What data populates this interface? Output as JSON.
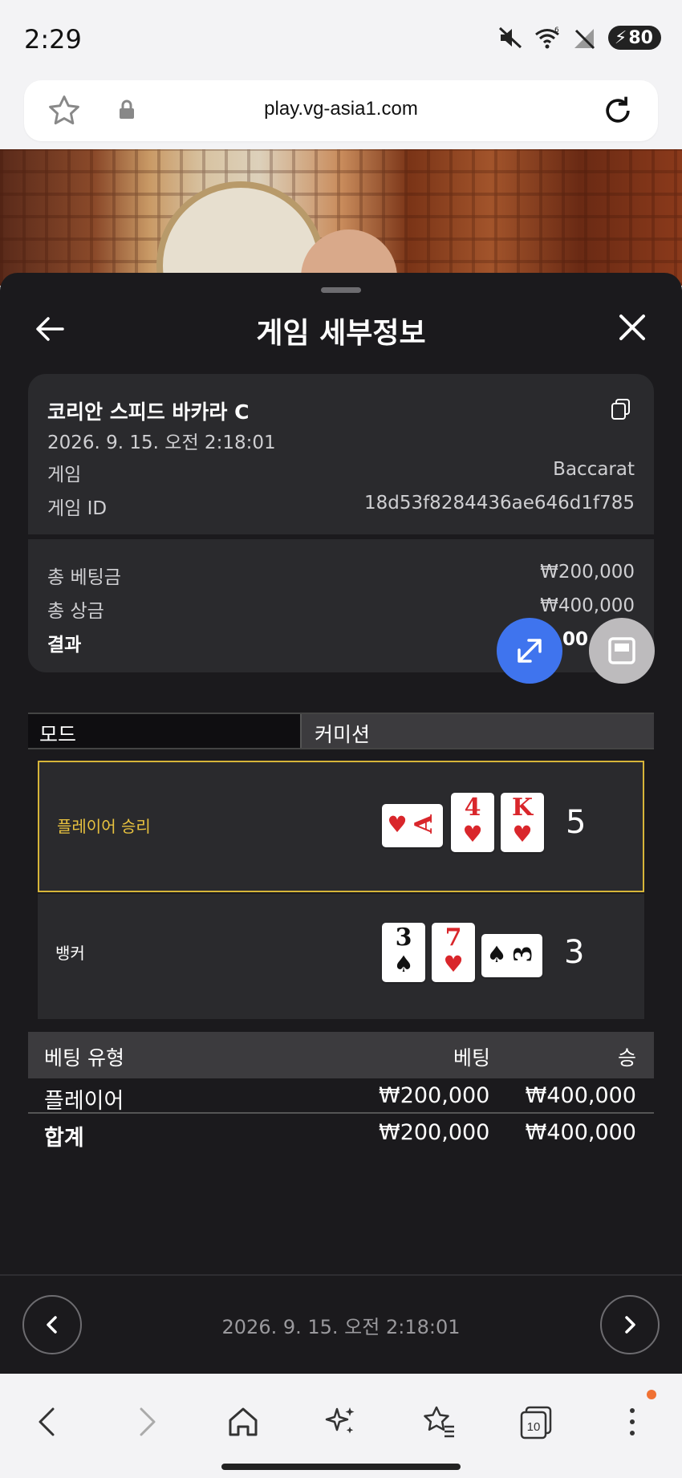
{
  "status_bar": {
    "time": "2:29",
    "battery": "80",
    "wifi_badge": "6"
  },
  "browser": {
    "url": "play.vg-asia1.com",
    "tabs_count": "10"
  },
  "sheet": {
    "title": "게임 세부정보"
  },
  "game": {
    "name": "코리안 스피드 바카라 C",
    "datetime": "2026. 9. 15. 오전 2:18:01",
    "game_label": "게임",
    "game_value": "Baccarat",
    "id_label": "게임 ID",
    "id_value": "18d53f8284436ae646d1f785"
  },
  "totals": {
    "bet_label": "총 베팅금",
    "bet_value": "₩200,000",
    "payout_label": "총 상금",
    "payout_value": "₩400,000",
    "result_label": "결과",
    "result_value": "00"
  },
  "mode": {
    "mode_label": "모드",
    "commission_label": "커미션"
  },
  "hands": {
    "player": {
      "label": "플레이어 승리",
      "score": "5",
      "cards": [
        {
          "rank": "A",
          "suit": "♥",
          "orientation": "horizontal",
          "color": "red"
        },
        {
          "rank": "4",
          "suit": "♥",
          "orientation": "vertical",
          "color": "red"
        },
        {
          "rank": "K",
          "suit": "♥",
          "orientation": "vertical",
          "color": "red"
        }
      ]
    },
    "banker": {
      "label": "뱅커",
      "score": "3",
      "cards": [
        {
          "rank": "3",
          "suit": "♠",
          "orientation": "vertical",
          "color": "black"
        },
        {
          "rank": "7",
          "suit": "♥",
          "orientation": "vertical",
          "color": "red"
        },
        {
          "rank": "3",
          "suit": "♠",
          "orientation": "horizontal",
          "color": "black"
        }
      ]
    }
  },
  "bet_table": {
    "headers": {
      "type": "베팅 유형",
      "bet": "베팅",
      "win": "승"
    },
    "rows": [
      {
        "type": "플레이어",
        "bet": "₩200,000",
        "win": "₩400,000"
      }
    ],
    "total": {
      "type": "합계",
      "bet": "₩200,000",
      "win": "₩400,000"
    }
  },
  "footer": {
    "datetime": "2026. 9. 15. 오전 2:18:01"
  },
  "colors": {
    "sheet_bg": "#1b1a1d",
    "card_bg": "#2a2a2d",
    "win_highlight": "#d7b539",
    "fab_blue": "#3f74ee",
    "card_red": "#d9262b"
  },
  "icons": {
    "back": "arrow-left-icon",
    "close": "close-icon",
    "copy": "copy-icon",
    "expand": "expand-icon",
    "pip": "picture-in-picture-icon",
    "trophy": "trophy-icon",
    "prev": "chevron-left-icon",
    "next": "chevron-right-icon"
  }
}
